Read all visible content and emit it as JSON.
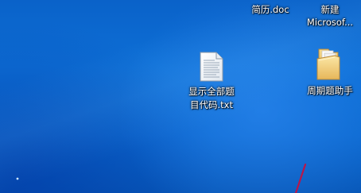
{
  "desktop": {
    "icons": [
      {
        "name": "resume-doc",
        "label": "简历.doc"
      },
      {
        "name": "new-microsoft",
        "label_line1": "新建",
        "label_line2": "Microsof..."
      },
      {
        "name": "show-all-code-txt",
        "label_line1": "显示全部题",
        "label_line2": "目代码.txt",
        "icon": "text-file-icon"
      },
      {
        "name": "weekly-assistant-folder",
        "label": "周期题助手",
        "icon": "folder-icon"
      }
    ],
    "colors": {
      "background": "#0b68cf",
      "label_text": "#ffffff"
    }
  }
}
